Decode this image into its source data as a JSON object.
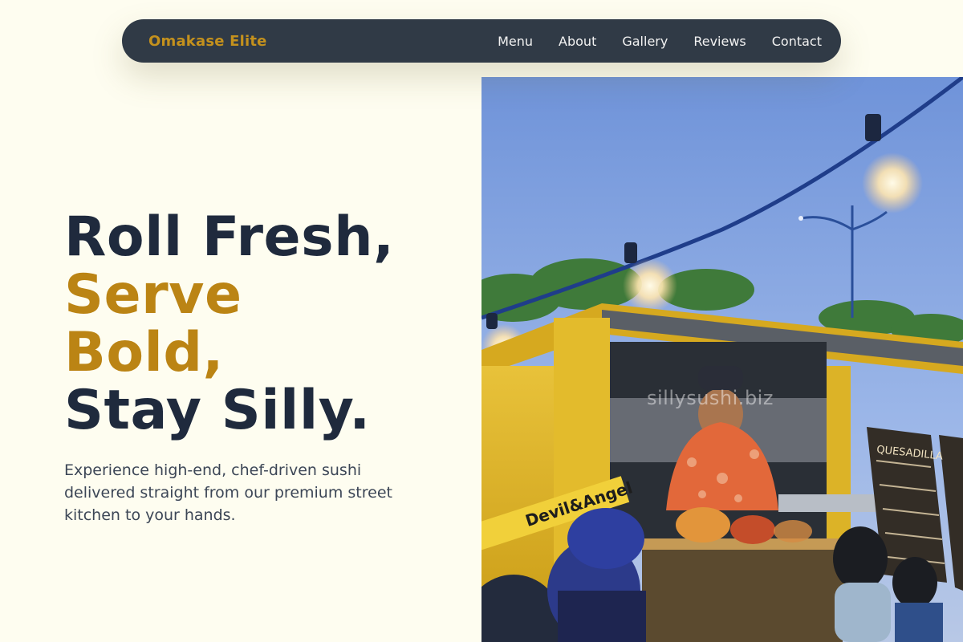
{
  "nav": {
    "brand": "Omakase Elite",
    "links": [
      "Menu",
      "About",
      "Gallery",
      "Reviews",
      "Contact"
    ]
  },
  "hero": {
    "headline_line1": "Roll Fresh,",
    "headline_line2": "Serve",
    "headline_line3": "Bold,",
    "headline_line4": "Stay Silly.",
    "subtext": "Experience high-end, chef-driven sushi delivered straight from our premium street kitchen to your hands."
  },
  "image": {
    "watermark": "sillysushi.biz",
    "truck_sign": "Devil&Angel",
    "menu_board": "QUESADILLA"
  },
  "colors": {
    "background": "#fefdf0",
    "nav_bg": "#303a46",
    "brand_gold": "#c4911d",
    "headline_dark": "#1f2a3d",
    "headline_accent": "#bb8414",
    "body_text": "#3c4656"
  }
}
